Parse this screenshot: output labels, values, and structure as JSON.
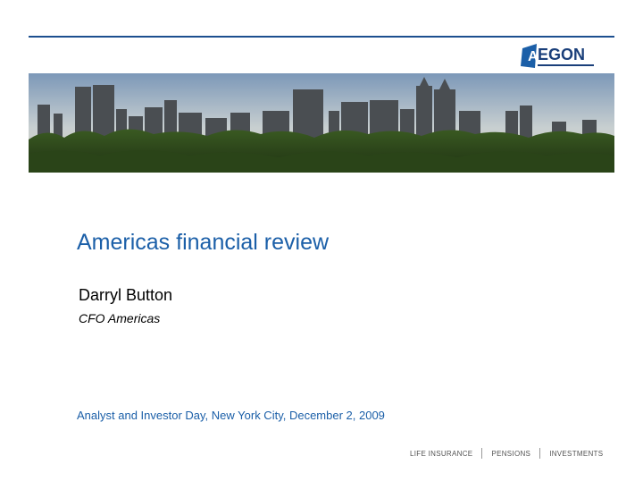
{
  "header": {
    "logo_text": "EGON",
    "logo_letter": "A"
  },
  "slide": {
    "title": "Americas financial review",
    "presenter": "Darryl Button",
    "role": "CFO Americas",
    "event": "Analyst and Investor Day, New York City, December 2, 2009"
  },
  "footer": {
    "taglines": [
      "LIFE INSURANCE",
      "PENSIONS",
      "INVESTMENTS"
    ]
  },
  "colors": {
    "brand_blue": "#1b5fa8",
    "rule": "#1c4f8f"
  }
}
